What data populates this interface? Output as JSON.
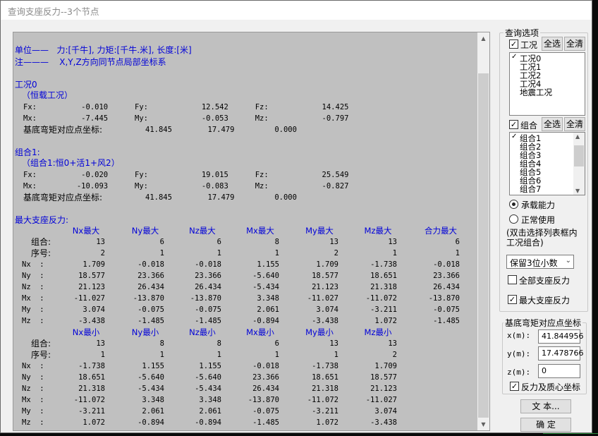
{
  "window": {
    "title": "查询支座反力--3个节点"
  },
  "report": {
    "unit_line": "单位——   力:[千牛], 力矩:[千牛.米], 长度:[米]",
    "note_line": "注———    X,Y,Z方向同节点局部坐标系",
    "case0_title": "工况0",
    "case0_sub": "（恒载工况）",
    "case0_row1": "Fx:          -0.010      Fy:            12.542      Fz:            14.425",
    "case0_row2": "Mx:          -7.445      My:            -0.053      Mz:            -0.797",
    "case0_base_label": "基底弯矩对应点坐标:",
    "case0_base_vals": "41.845        17.479         0.000",
    "comb1_title": "组合1:",
    "comb1_sub": "（组合1:恒0+活1+风2）",
    "comb1_row1": "Fx:          -0.020      Fy:            19.015      Fz:            25.549",
    "comb1_row2": "Mx:         -10.093      My:            -0.083      Mz:            -0.827",
    "comb1_base_label": "基底弯矩对应点坐标:",
    "comb1_base_vals": "41.845        17.479         0.000",
    "max_title": "最大支座反力:",
    "max_headers": [
      "Nx最大",
      "Ny最大",
      "Nz最大",
      "Mx最大",
      "My最大",
      "Mz最大",
      "合力最大"
    ],
    "max_rows": [
      {
        "label": "组合:",
        "vals": [
          "13",
          "6",
          "6",
          "8",
          "13",
          "13",
          "6"
        ]
      },
      {
        "label": "序号:",
        "vals": [
          "2",
          "1",
          "1",
          "1",
          "2",
          "1",
          "1"
        ]
      },
      {
        "label": "Nx  :",
        "vals": [
          "1.709",
          "-0.018",
          "-0.018",
          "1.155",
          "1.709",
          "-1.738",
          "-0.018"
        ]
      },
      {
        "label": "Ny  :",
        "vals": [
          "18.577",
          "23.366",
          "23.366",
          "-5.640",
          "18.577",
          "18.651",
          "23.366"
        ]
      },
      {
        "label": "Nz  :",
        "vals": [
          "21.123",
          "26.434",
          "26.434",
          "-5.434",
          "21.123",
          "21.318",
          "26.434"
        ]
      },
      {
        "label": "Mx  :",
        "vals": [
          "-11.027",
          "-13.870",
          "-13.870",
          "3.348",
          "-11.027",
          "-11.072",
          "-13.870"
        ]
      },
      {
        "label": "My  :",
        "vals": [
          "3.074",
          "-0.075",
          "-0.075",
          "2.061",
          "3.074",
          "-3.211",
          "-0.075"
        ]
      },
      {
        "label": "Mz  :",
        "vals": [
          "-3.438",
          "-1.485",
          "-1.485",
          "-0.894",
          "-3.438",
          "1.072",
          "-1.485"
        ]
      }
    ],
    "min_headers": [
      "Nx最小",
      "Ny最小",
      "Nz最小",
      "Mx最小",
      "My最小",
      "Mz最小"
    ],
    "min_rows": [
      {
        "label": "组合:",
        "vals": [
          "13",
          "8",
          "8",
          "6",
          "13",
          "13"
        ]
      },
      {
        "label": "序号:",
        "vals": [
          "1",
          "1",
          "1",
          "1",
          "1",
          "2"
        ]
      },
      {
        "label": "Nx  :",
        "vals": [
          "-1.738",
          "1.155",
          "1.155",
          "-0.018",
          "-1.738",
          "1.709"
        ]
      },
      {
        "label": "Ny  :",
        "vals": [
          "18.651",
          "-5.640",
          "-5.640",
          "23.366",
          "18.651",
          "18.577"
        ]
      },
      {
        "label": "Nz  :",
        "vals": [
          "21.318",
          "-5.434",
          "-5.434",
          "26.434",
          "21.318",
          "21.123"
        ]
      },
      {
        "label": "Mx  :",
        "vals": [
          "-11.072",
          "3.348",
          "3.348",
          "-13.870",
          "-11.072",
          "-11.027"
        ]
      },
      {
        "label": "My  :",
        "vals": [
          "-3.211",
          "2.061",
          "2.061",
          "-0.075",
          "-3.211",
          "3.074"
        ]
      },
      {
        "label": "Mz  :",
        "vals": [
          "1.072",
          "-0.894",
          "-0.894",
          "-1.485",
          "1.072",
          "-3.438"
        ]
      }
    ]
  },
  "options": {
    "group_title": "查询选项",
    "case_label": "工况",
    "select_all": "全选",
    "clear_all": "全清",
    "cases": [
      "工况0",
      "工况1",
      "工况2",
      "工况4",
      "地震工况"
    ],
    "comb_label": "组合",
    "combs": [
      "组合1",
      "组合2",
      "组合3",
      "组合4",
      "组合5",
      "组合6",
      "组合7"
    ],
    "radio_capacity": "承载能力",
    "radio_normal": "正常使用",
    "hint": "(双击选择列表框内工况组合)",
    "decimal_select": "保留3位小数",
    "all_reaction": "全部支座反力",
    "max_reaction": "最大支座反力"
  },
  "coord": {
    "group_title": "基底弯矩对应点坐标",
    "x_label": "x(m):",
    "x_value": "41.844956",
    "y_label": "y(m):",
    "y_value": "17.478766",
    "z_label": "z(m):",
    "z_value": "0",
    "mass_check": "反力及质心坐标"
  },
  "buttons": {
    "text": "文 本...",
    "ok": "确 定"
  }
}
